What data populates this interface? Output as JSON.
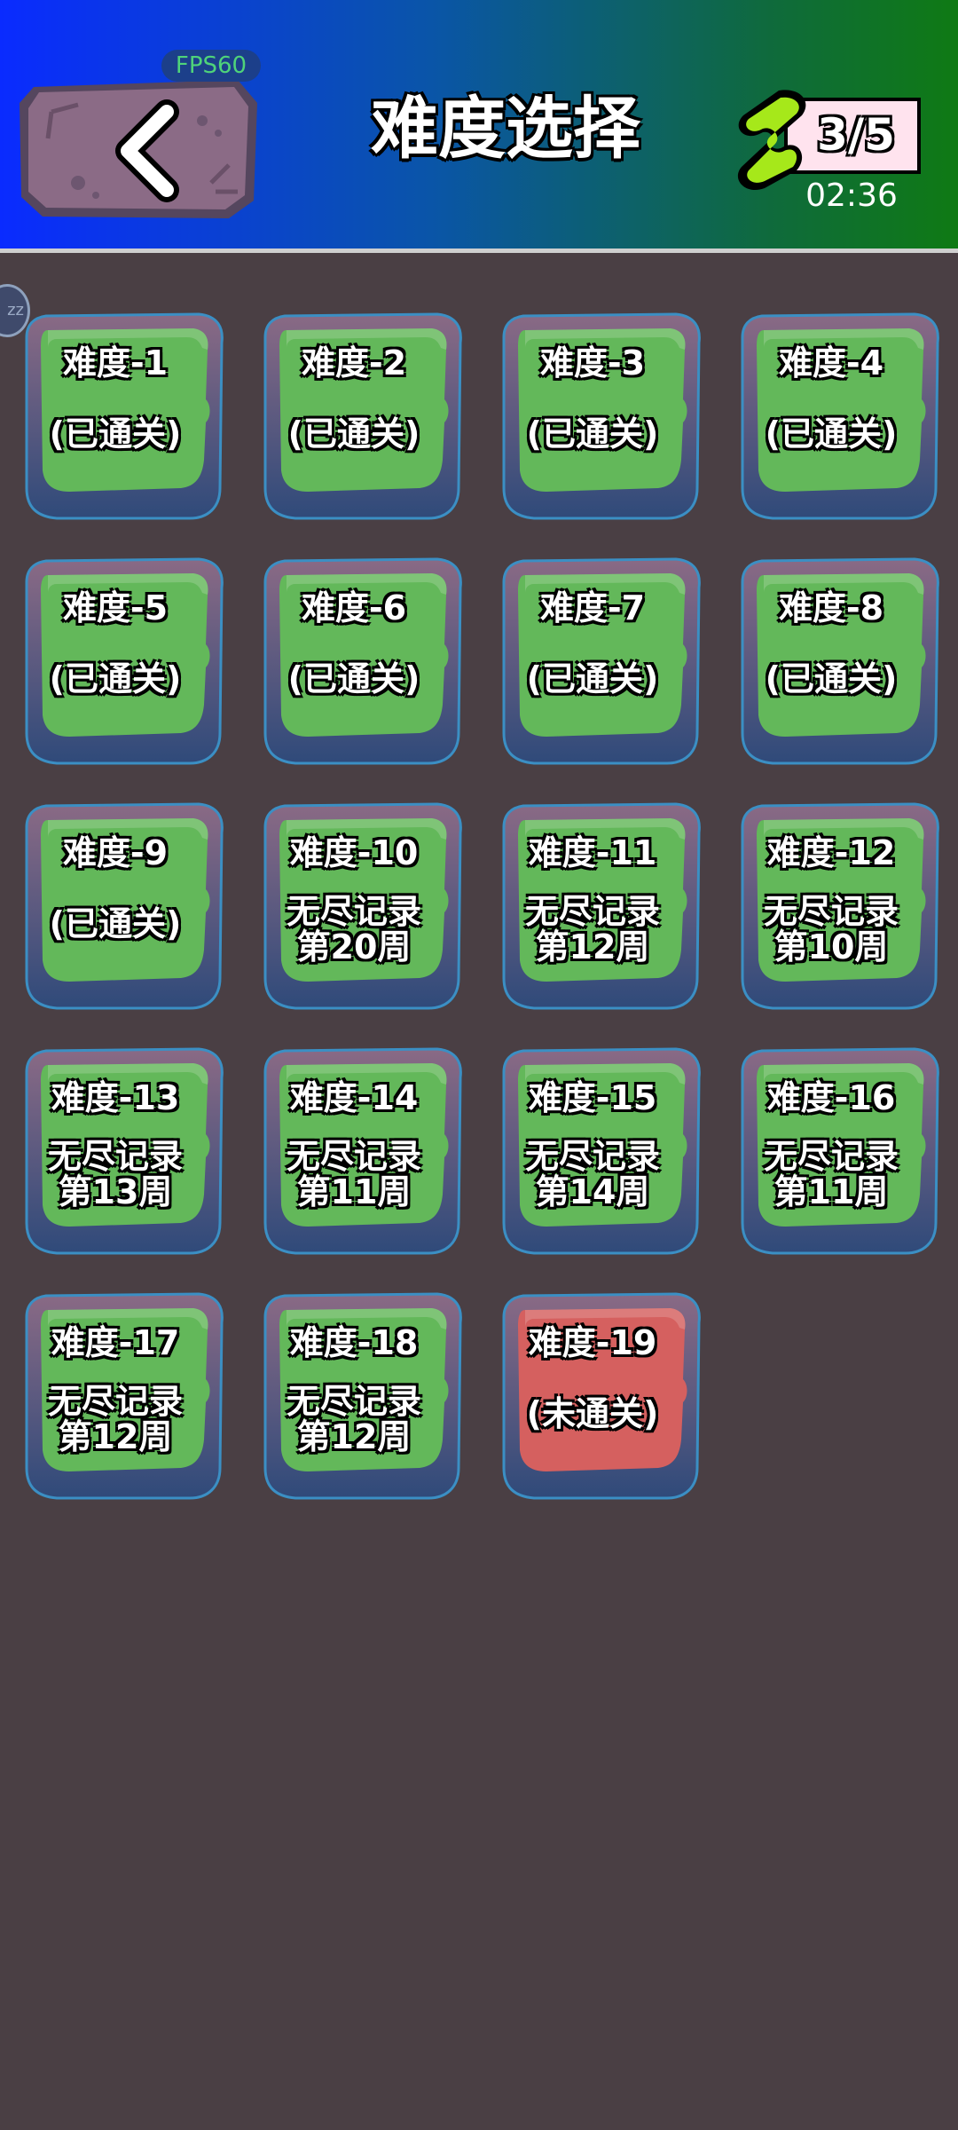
{
  "header": {
    "fps": "FPS60",
    "title": "难度选择",
    "energy": "3/5",
    "timer": "02:36",
    "gradient": [
      "#0a2bff",
      "#0f7a14"
    ]
  },
  "side_bubble": "zz",
  "levels": [
    {
      "name": "难度-1",
      "status": "(已通关)",
      "state": "cleared"
    },
    {
      "name": "难度-2",
      "status": "(已通关)",
      "state": "cleared"
    },
    {
      "name": "难度-3",
      "status": "(已通关)",
      "state": "cleared"
    },
    {
      "name": "难度-4",
      "status": "(已通关)",
      "state": "cleared"
    },
    {
      "name": "难度-5",
      "status": "(已通关)",
      "state": "cleared"
    },
    {
      "name": "难度-6",
      "status": "(已通关)",
      "state": "cleared"
    },
    {
      "name": "难度-7",
      "status": "(已通关)",
      "state": "cleared"
    },
    {
      "name": "难度-8",
      "status": "(已通关)",
      "state": "cleared"
    },
    {
      "name": "难度-9",
      "status": "(已通关)",
      "state": "cleared"
    },
    {
      "name": "难度-10",
      "record": "无尽记录",
      "weeks": "第20周",
      "state": "endless"
    },
    {
      "name": "难度-11",
      "record": "无尽记录",
      "weeks": "第12周",
      "state": "endless"
    },
    {
      "name": "难度-12",
      "record": "无尽记录",
      "weeks": "第10周",
      "state": "endless"
    },
    {
      "name": "难度-13",
      "record": "无尽记录",
      "weeks": "第13周",
      "state": "endless"
    },
    {
      "name": "难度-14",
      "record": "无尽记录",
      "weeks": "第11周",
      "state": "endless"
    },
    {
      "name": "难度-15",
      "record": "无尽记录",
      "weeks": "第14周",
      "state": "endless"
    },
    {
      "name": "难度-16",
      "record": "无尽记录",
      "weeks": "第11周",
      "state": "endless"
    },
    {
      "name": "难度-17",
      "record": "无尽记录",
      "weeks": "第12周",
      "state": "endless"
    },
    {
      "name": "难度-18",
      "record": "无尽记录",
      "weeks": "第12周",
      "state": "endless"
    },
    {
      "name": "难度-19",
      "status": "(未通关)",
      "state": "locked"
    }
  ],
  "colors": {
    "cleared": "#63b85a",
    "endless": "#63b85a",
    "locked": "#d5605f",
    "frame": "#3d4a73"
  }
}
